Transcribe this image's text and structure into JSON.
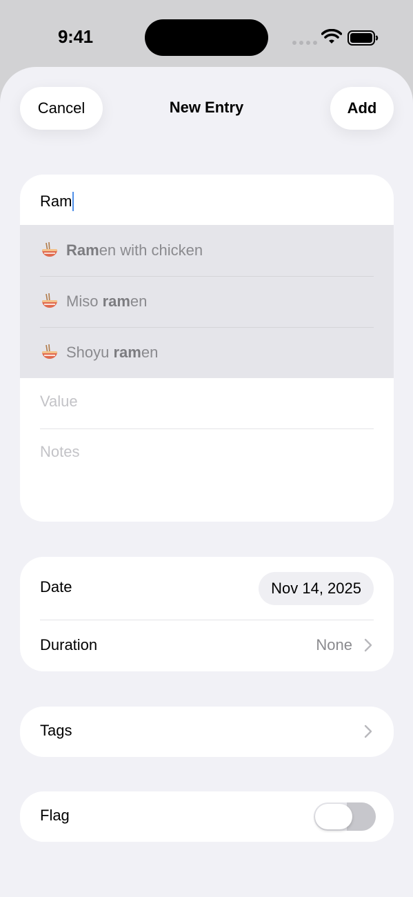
{
  "status_bar": {
    "time": "9:41"
  },
  "nav": {
    "cancel_label": "Cancel",
    "title": "New Entry",
    "add_label": "Add"
  },
  "entry": {
    "name_value": "Ram",
    "suggestions": [
      {
        "icon": "ramen-bowl-icon",
        "match": "Ram",
        "rest": "en with chicken",
        "prefix": ""
      },
      {
        "icon": "ramen-bowl-icon",
        "prefix": "Miso ",
        "match": "ram",
        "rest": "en"
      },
      {
        "icon": "ramen-bowl-icon",
        "prefix": "Shoyu ",
        "match": "ram",
        "rest": "en"
      }
    ],
    "value_placeholder": "Value",
    "notes_placeholder": "Notes"
  },
  "details": {
    "date_label": "Date",
    "date_value": "Nov 14, 2025",
    "duration_label": "Duration",
    "duration_value": "None"
  },
  "tags": {
    "label": "Tags"
  },
  "flag": {
    "label": "Flag",
    "enabled": false
  },
  "colors": {
    "background": "#f1f1f6",
    "card": "#ffffff",
    "suggestion_bg": "#e5e5ea",
    "caret": "#4f8fe8",
    "secondary_text": "#8a8a8e",
    "placeholder_text": "#c3c3c7"
  }
}
